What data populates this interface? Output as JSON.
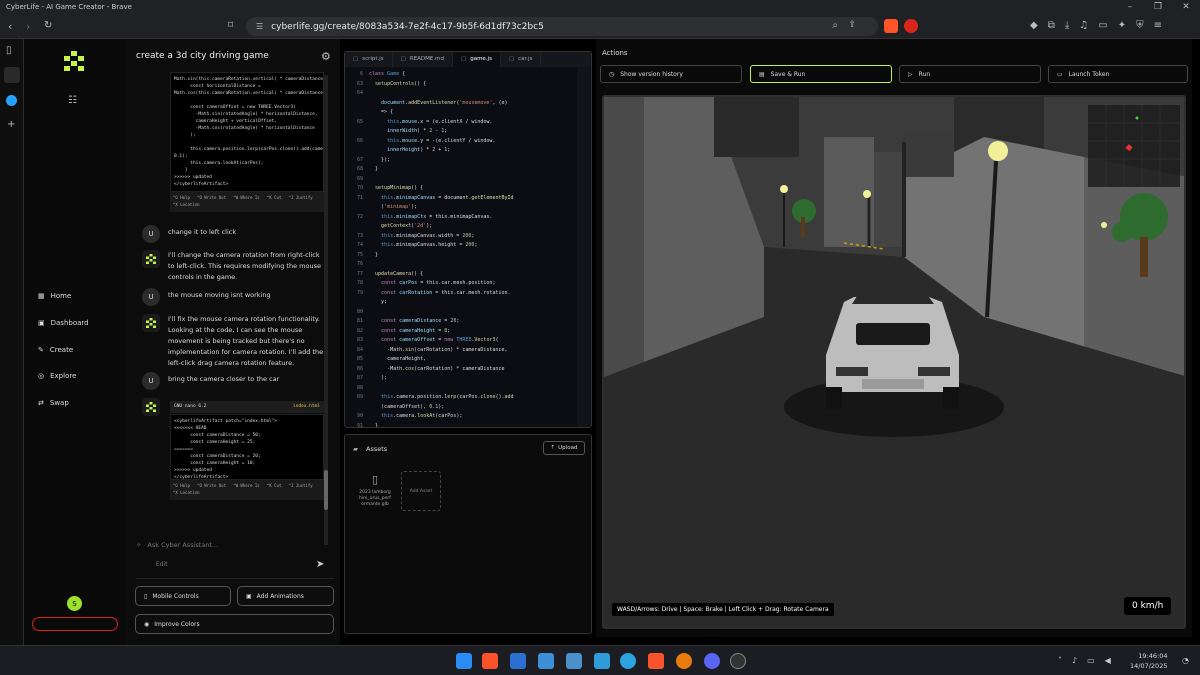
{
  "window": {
    "title": "CyberLife - AI Game Creator - Brave"
  },
  "browser": {
    "url": "cyberlife.gg/create/8083a534-7e2f-4c17-9b5f-6d1df73c2bc5"
  },
  "sidebar": {
    "items": [
      {
        "label": "Home",
        "icon": "grid-icon"
      },
      {
        "label": "Dashboard",
        "icon": "dashboard-icon"
      },
      {
        "label": "Create",
        "icon": "wand-icon"
      },
      {
        "label": "Explore",
        "icon": "compass-icon"
      },
      {
        "label": "Swap",
        "icon": "swap-icon"
      }
    ],
    "user_initial": "S"
  },
  "chat": {
    "title": "create a 3d city driving game",
    "term1": "Math.sin(this.cameraRotation.vertical) * cameraDistance;\n      const horizontalDistance =\nMath.cos(this.cameraRotation.vertical) * cameraDistance;\n\n      const cameraOffset = new THREE.Vector3(\n        -Math.sin(rotatedAngle) * horizontalDistance,\n        cameraHeight + verticalOffset,\n        -Math.cos(rotatedAngle) * horizontalDistance\n      );\n\n      this.camera.position.lerp(carPos.clone().add(cameraOffset),\n0.1);\n      this.camera.lookAt(carPos);\n    }\n>>>>>> updated\n</cyberlifeArtifact>",
    "term1_footer": "^G Help   ^O Write Out   ^W Where Is   ^K Cut   ^J Justify\n^X Location",
    "messages": [
      {
        "role": "U",
        "text": "change it to left click"
      },
      {
        "role": "ai",
        "text": "I'll change the camera rotation from right-click to left-click. This requires modifying the mouse controls in the game."
      },
      {
        "role": "U",
        "text": "the mouse moving isnt working"
      },
      {
        "role": "ai",
        "text": "I'll fix the mouse camera rotation functionality. Looking at the code, I can see the mouse movement is being tracked but there's no implementation for camera rotation. I'll add the left-click drag camera rotation feature."
      },
      {
        "role": "U",
        "text": "bring the camera closer to the car"
      }
    ],
    "term2_header": "GNU nano 6.2",
    "term2_file": "index.html",
    "term2": "<cyberlifeArtifact patch=\"index.html\">\n<<<<<<< HEAD\n      const cameraDistance = 50;\n      const cameraHeight = 25;\n=======\n      const cameraDistance = 20;\n      const cameraHeight = 10;\n>>>>>> updated\n</cyberlifeArtifact>",
    "term2_footer": "^G Help   ^O Write Out   ^W Where Is   ^K Cut   ^J Justify\n^X Location",
    "input_placeholder": "Ask Cyber Assistant...",
    "edit_label": "Edit",
    "buttons": {
      "mobile": "Mobile Controls",
      "anim": "Add Animations",
      "colors": "Improve Colors"
    }
  },
  "editor": {
    "tabs": [
      "script.js",
      "README.md",
      "game.js",
      "car.js"
    ],
    "active_tab": 2,
    "lines": [
      {
        "n": "6",
        "h": "<span class='kw'>class</span> <span class='th'>Game</span> <span class='pl'>{</span>"
      },
      {
        "n": "63",
        "h": "  <span class='fn'>setupControls</span><span class='pl'>() {</span>"
      },
      {
        "n": "64",
        "h": ""
      },
      {
        "n": "",
        "h": "    <span class='pr'>document</span><span class='pl'>.</span><span class='fn'>addEventListener</span><span class='pl'>(</span><span class='st'>'mousemove'</span><span class='pl'>, (e)</span>"
      },
      {
        "n": "",
        "h": "    <span class='pl'>=> {</span>"
      },
      {
        "n": "65",
        "h": "      <span class='th'>this</span><span class='pl'>.</span><span class='pr'>mouse</span><span class='pl'>.x = (e.clientX / window.</span>"
      },
      {
        "n": "",
        "h": "      <span class='pr'>innerWidth</span><span class='pl'>) * </span><span class='nu'>2</span><span class='pl'> - </span><span class='nu'>1</span><span class='pl'>;</span>"
      },
      {
        "n": "66",
        "h": "      <span class='th'>this</span><span class='pl'>.</span><span class='pr'>mouse</span><span class='pl'>.y = -(e.clientY / window.</span>"
      },
      {
        "n": "",
        "h": "      <span class='pr'>innerHeight</span><span class='pl'>) * </span><span class='nu'>2</span><span class='pl'> + </span><span class='nu'>1</span><span class='pl'>;</span>"
      },
      {
        "n": "67",
        "h": "    <span class='pl'>});</span>"
      },
      {
        "n": "68",
        "h": "  <span class='pl'>}</span>"
      },
      {
        "n": "69",
        "h": ""
      },
      {
        "n": "70",
        "h": "  <span class='fn'>setupMinimap</span><span class='pl'>() {</span>"
      },
      {
        "n": "71",
        "h": "    <span class='th'>this</span><span class='pl'>.</span><span class='pr'>minimapCanvas</span><span class='pl'> = document.</span><span class='fn'>getElementById</span>"
      },
      {
        "n": "",
        "h": "    <span class='pl'>(</span><span class='st'>'minimap'</span><span class='pl'>);</span>"
      },
      {
        "n": "72",
        "h": "    <span class='th'>this</span><span class='pl'>.</span><span class='pr'>minimapCtx</span><span class='pl'> = this.minimapCanvas.</span>"
      },
      {
        "n": "",
        "h": "    <span class='fn'>getContext</span><span class='pl'>(</span><span class='st'>'2d'</span><span class='pl'>);</span>"
      },
      {
        "n": "73",
        "h": "    <span class='th'>this</span><span class='pl'>.minimapCanvas.width = </span><span class='nu'>200</span><span class='pl'>;</span>"
      },
      {
        "n": "74",
        "h": "    <span class='th'>this</span><span class='pl'>.minimapCanvas.height = </span><span class='nu'>200</span><span class='pl'>;</span>"
      },
      {
        "n": "75",
        "h": "  <span class='pl'>}</span>"
      },
      {
        "n": "76",
        "h": ""
      },
      {
        "n": "77",
        "h": "  <span class='fn'>updateCamera</span><span class='pl'>() {</span>"
      },
      {
        "n": "78",
        "h": "    <span class='kw'>const</span> <span class='pr'>carPos</span><span class='pl'> = this.car.mesh.position;</span>"
      },
      {
        "n": "79",
        "h": "    <span class='kw'>const</span> <span class='pr'>carRotation</span><span class='pl'> = this.car.mesh.rotation.</span>"
      },
      {
        "n": "",
        "h": "    <span class='pl'>y;</span>"
      },
      {
        "n": "80",
        "h": ""
      },
      {
        "n": "81",
        "h": "    <span class='kw'>const</span> <span class='pr'>cameraDistance</span><span class='pl'> = </span><span class='nu'>20</span><span class='pl'>;</span>"
      },
      {
        "n": "82",
        "h": "    <span class='kw'>const</span> <span class='pr'>cameraHeight</span><span class='pl'> = </span><span class='nu'>8</span><span class='pl'>;</span>"
      },
      {
        "n": "83",
        "h": "    <span class='kw'>const</span> <span class='pr'>cameraOffset</span><span class='pl'> = </span><span class='kw'>new</span> <span class='th'>THREE</span><span class='pl'>.</span><span class='fn'>Vector3</span><span class='pl'>(</span>"
      },
      {
        "n": "84",
        "h": "      <span class='pl'>-Math.</span><span class='fn'>sin</span><span class='pl'>(carRotation) * cameraDistance,</span>"
      },
      {
        "n": "85",
        "h": "      <span class='pl'>cameraHeight,</span>"
      },
      {
        "n": "86",
        "h": "      <span class='pl'>-Math.</span><span class='fn'>cos</span><span class='pl'>(carRotation) * cameraDistance</span>"
      },
      {
        "n": "87",
        "h": "    <span class='pl'>);</span>"
      },
      {
        "n": "88",
        "h": ""
      },
      {
        "n": "89",
        "h": "    <span class='th'>this</span><span class='pl'>.camera.position.</span><span class='fn'>lerp</span><span class='pl'>(carPos.</span><span class='fn'>clone</span><span class='pl'>().</span><span class='fn'>add</span>"
      },
      {
        "n": "",
        "h": "    <span class='pl'>(cameraOffset), </span><span class='nu'>0.1</span><span class='pl'>);</span>"
      },
      {
        "n": "90",
        "h": "    <span class='th'>this</span><span class='pl'>.camera.</span><span class='fn'>lookAt</span><span class='pl'>(carPos);</span>"
      },
      {
        "n": "91",
        "h": "  <span class='pl'>}</span>"
      },
      {
        "n": "92",
        "h": ""
      },
      {
        "n": "93",
        "h": "  <span class='fn'>updateMinimap</span><span class='pl'>() {</span>"
      },
      {
        "n": "94",
        "h": "    <span class='kw'>const</span> <span class='pr'>ctx</span><span class='pl'> = this.minimapCtx;</span>"
      },
      {
        "n": "95",
        "h": "    <span class='pl'>ctx.fillStyle = </span><span class='st'>'#1a1a1a'</span><span class='pl'>;</span>"
      },
      {
        "n": "96",
        "h": "    <span class='pl'>ctx.</span><span class='fn'>fillRect</span><span class='pl'>(</span><span class='nu'>0</span><span class='pl'>, </span><span class='nu'>0</span><span class='pl'>, </span><span class='nu'>200</span><span class='pl'>, </span><span class='nu'>200</span><span class='pl'>);</span>"
      },
      {
        "n": "97",
        "h": ""
      },
      {
        "n": "98",
        "h": "    <span class='kw'>const</span> <span class='pr'>scale</span><span class='pl'> = </span><span class='nu'>0.5</span><span class='pl'>;</span>"
      }
    ]
  },
  "assets": {
    "title": "Assets",
    "upload_label": "Upload",
    "file_name": "2023 lamborghini_urus_performante.glb",
    "add_label": "Add Asset"
  },
  "actions": {
    "title": "Actions",
    "history": "Show version history",
    "save_run": "Save & Run",
    "run": "Run",
    "launch": "Launch Token"
  },
  "game": {
    "hud_controls": "WASD/Arrows: Drive | Space: Brake | Left Click + Drag: Rotate Camera",
    "speed": "0 km/h"
  },
  "taskbar": {
    "time": "19:46:04",
    "date": "14/07/2025"
  },
  "colors": {
    "accent": "#c6f24e",
    "brand_green": "#9be22d",
    "danger": "#d9261c"
  }
}
